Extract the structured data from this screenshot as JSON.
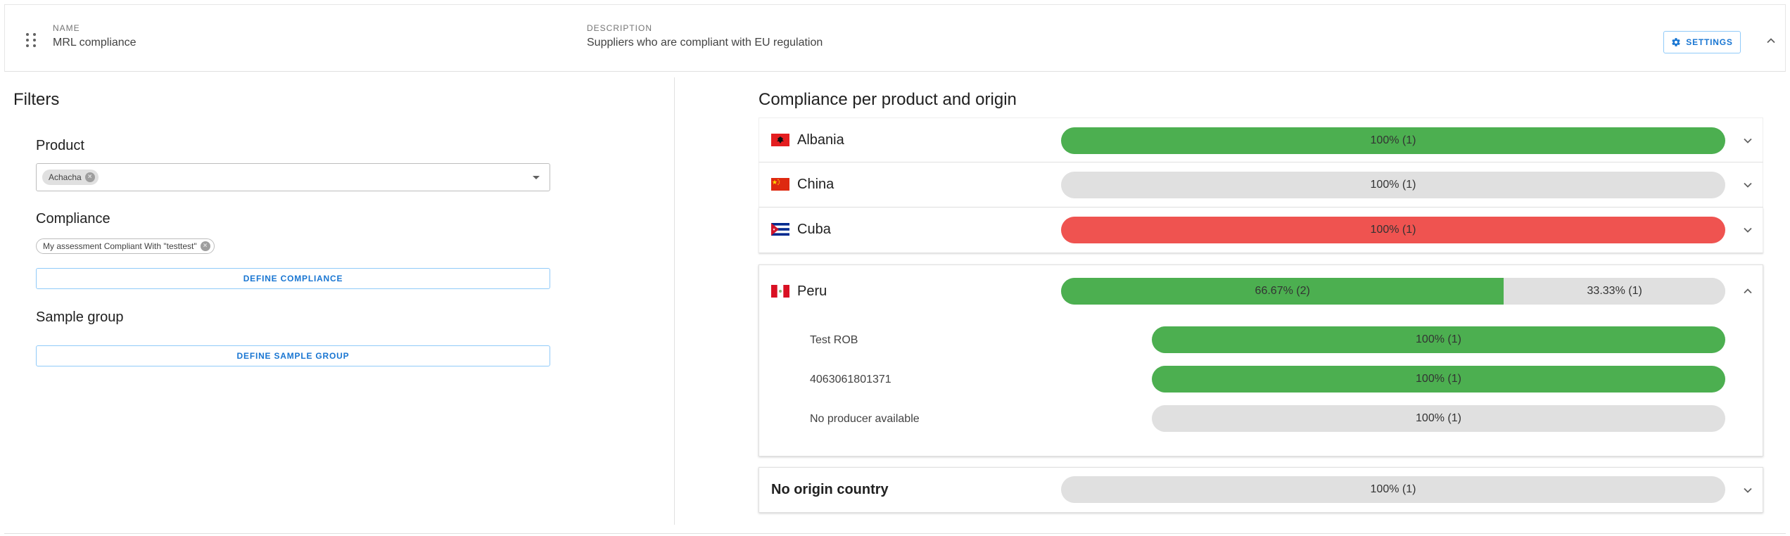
{
  "header": {
    "name_label": "NAME",
    "name_value": "MRL compliance",
    "description_label": "DESCRIPTION",
    "description_value": "Suppliers who are compliant with EU regulation",
    "settings_label": "SETTINGS"
  },
  "filters": {
    "title": "Filters",
    "product_label": "Product",
    "product_chip": "Achacha",
    "compliance_label": "Compliance",
    "compliance_chip": "My assessment Compliant With \"testtest\"",
    "define_compliance_label": "DEFINE COMPLIANCE",
    "sample_group_label": "Sample group",
    "define_sample_group_label": "DEFINE SAMPLE GROUP"
  },
  "compliance": {
    "title": "Compliance per product and origin",
    "colors": {
      "green": "#4caf50",
      "red": "#ef5350",
      "grey": "#e0e0e0",
      "accent": "#1976d2"
    },
    "rows": [
      {
        "country": "Albania",
        "flag": "albania-flag-icon",
        "segments": [
          {
            "label": "100% (1)",
            "fraction": 1.0,
            "status": "green"
          }
        ]
      },
      {
        "country": "China",
        "flag": "china-flag-icon",
        "segments": [
          {
            "label": "100% (1)",
            "fraction": 1.0,
            "status": "grey"
          }
        ]
      },
      {
        "country": "Cuba",
        "flag": "cuba-flag-icon",
        "segments": [
          {
            "label": "100% (1)",
            "fraction": 1.0,
            "status": "red"
          }
        ]
      },
      {
        "country": "Peru",
        "flag": "peru-flag-icon",
        "expanded": true,
        "segments": [
          {
            "label": "66.67% (2)",
            "fraction": 0.6667,
            "status": "green"
          },
          {
            "label": "33.33% (1)",
            "fraction": 0.3333,
            "status": "grey"
          }
        ],
        "producers": [
          {
            "name": "Test ROB",
            "label": "100% (1)",
            "status": "green"
          },
          {
            "name": "4063061801371",
            "label": "100% (1)",
            "status": "green"
          },
          {
            "name": "No producer available",
            "label": "100% (1)",
            "status": "grey"
          }
        ]
      },
      {
        "country": "No origin country",
        "segments": [
          {
            "label": "100% (1)",
            "fraction": 1.0,
            "status": "grey"
          }
        ]
      }
    ]
  }
}
